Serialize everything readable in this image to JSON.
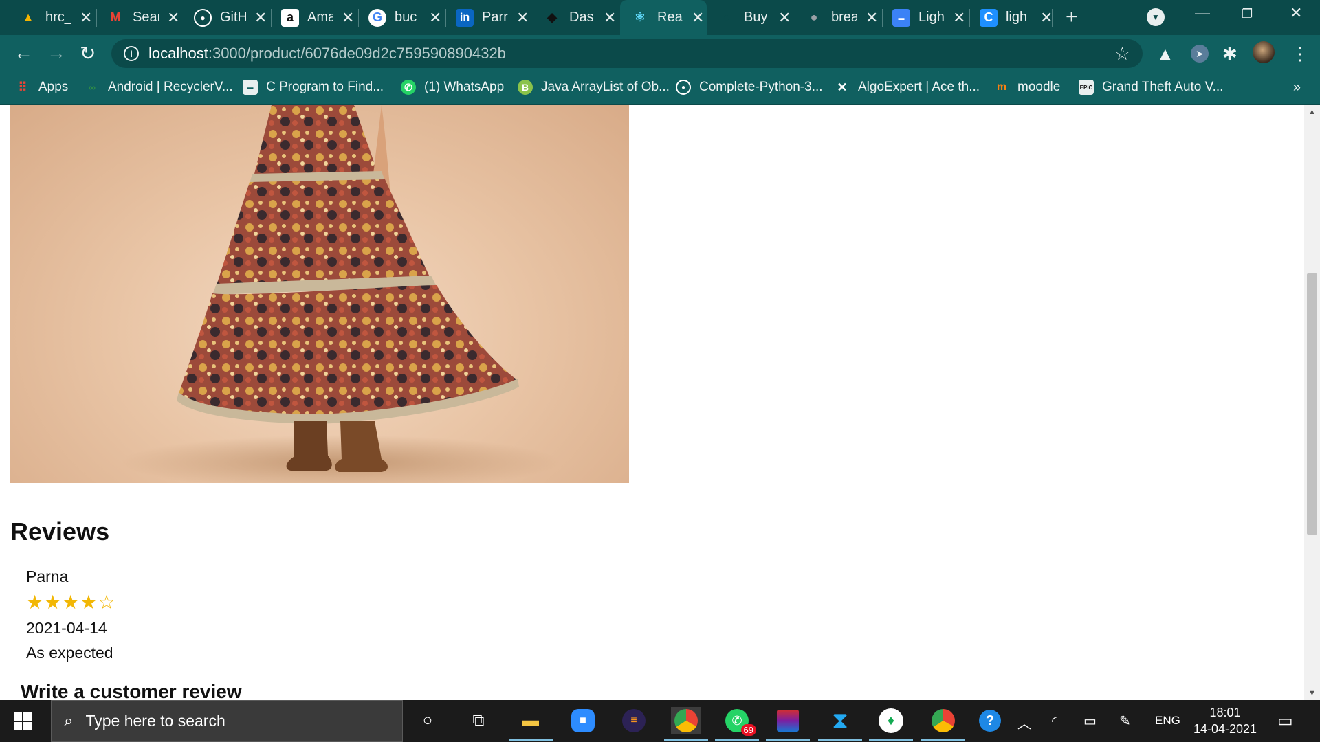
{
  "browser": {
    "tabs": [
      {
        "title": "hrc_",
        "icon": "google-drive-icon",
        "color": "#f4b400"
      },
      {
        "title": "Sear",
        "icon": "gmail-icon",
        "color": "#ea4335"
      },
      {
        "title": "GitH",
        "icon": "github-icon",
        "color": "#ffffff"
      },
      {
        "title": "Ama",
        "icon": "amazon-icon",
        "color": "#ffffff"
      },
      {
        "title": "buc",
        "icon": "google-icon",
        "color": "#4285f4"
      },
      {
        "title": "Parr",
        "icon": "linkedin-icon",
        "color": "#0a66c2"
      },
      {
        "title": "Das",
        "icon": "app-icon",
        "color": "#111111"
      },
      {
        "title": "Rea",
        "icon": "react-icon",
        "color": "#61dafb",
        "active": true
      },
      {
        "title": "Buy",
        "icon": "app-icon",
        "color": "#0b4a4a"
      },
      {
        "title": "brea",
        "icon": "globe-icon",
        "color": "#9aa0a6"
      },
      {
        "title": "Ligh",
        "icon": "app-icon",
        "color": "#3b82f6"
      },
      {
        "title": "ligh",
        "icon": "c-icon",
        "color": "#1e90ff"
      }
    ],
    "close_glyph": "✕",
    "new_tab_glyph": "+",
    "address": {
      "host": "localhost",
      "path": ":3000/product/6076de09d2c759590890432b"
    },
    "bookmarks": [
      {
        "label": "Apps",
        "icon": "apps-grid-icon"
      },
      {
        "label": "Android | RecyclerV...",
        "icon": "gfg-icon"
      },
      {
        "label": "C Program to Find...",
        "icon": "site-icon"
      },
      {
        "label": "(1) WhatsApp",
        "icon": "whatsapp-icon"
      },
      {
        "label": "Java ArrayList of Ob...",
        "icon": "b-icon"
      },
      {
        "label": "Complete-Python-3...",
        "icon": "github-icon"
      },
      {
        "label": "AlgoExpert | Ace th...",
        "icon": "algoexpert-icon"
      },
      {
        "label": "moodle",
        "icon": "moodle-icon"
      },
      {
        "label": "Grand Theft Auto V...",
        "icon": "epic-icon"
      }
    ],
    "bookmarks_more": "»"
  },
  "page": {
    "reviews_heading": "Reviews",
    "review": {
      "name": "Parna",
      "rating": 4,
      "max_rating": 5,
      "date": "2021-04-14",
      "comment": "As expected"
    },
    "write_review_heading": "Write a customer review"
  },
  "taskbar": {
    "search_placeholder": "Type here to search",
    "whatsapp_badge": "69",
    "language": "ENG",
    "time": "18:01",
    "date": "14-04-2021"
  },
  "colors": {
    "tab_strip": "#0b4a4a",
    "toolbar": "#106060",
    "star": "#f2b705"
  }
}
